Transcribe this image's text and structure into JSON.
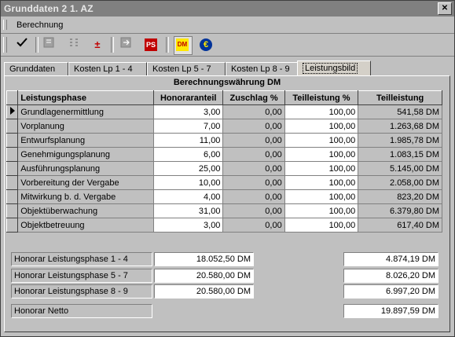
{
  "window": {
    "title": "Grunddaten 2 1. AZ"
  },
  "menu": {
    "items": [
      "Berechnung"
    ]
  },
  "toolbar": {
    "icons": [
      "checkmark-icon",
      "calc-icon",
      "split-icon",
      "plus-minus-icon",
      "export-icon",
      "ps-icon",
      "dm-currency-icon",
      "euro-currency-icon"
    ],
    "ps_label": "PS",
    "dm_label": "DM",
    "euro_label": "€"
  },
  "tabs": [
    {
      "label": "Grunddaten",
      "active": false
    },
    {
      "label": "Kosten Lp 1 - 4",
      "active": false
    },
    {
      "label": "Kosten Lp 5 - 7",
      "active": false
    },
    {
      "label": "Kosten Lp 8 - 9",
      "active": false
    },
    {
      "label": "Leistungsbild",
      "active": true
    }
  ],
  "grid": {
    "caption": "Berechnungswährung DM",
    "headers": [
      "Leistungsphase",
      "Honoraranteil",
      "Zuschlag %",
      "Teilleistung %",
      "Teilleistung"
    ],
    "rows": [
      {
        "phase": "Grundlagenermittlung",
        "honoraranteil": "3,00",
        "zuschlag": "0,00",
        "teilleistung_pct": "100,00",
        "teilleistung": "541,58 DM"
      },
      {
        "phase": "Vorplanung",
        "honoraranteil": "7,00",
        "zuschlag": "0,00",
        "teilleistung_pct": "100,00",
        "teilleistung": "1.263,68 DM"
      },
      {
        "phase": "Entwurfsplanung",
        "honoraranteil": "11,00",
        "zuschlag": "0,00",
        "teilleistung_pct": "100,00",
        "teilleistung": "1.985,78 DM"
      },
      {
        "phase": "Genehmigungsplanung",
        "honoraranteil": "6,00",
        "zuschlag": "0,00",
        "teilleistung_pct": "100,00",
        "teilleistung": "1.083,15 DM"
      },
      {
        "phase": "Ausführungsplanung",
        "honoraranteil": "25,00",
        "zuschlag": "0,00",
        "teilleistung_pct": "100,00",
        "teilleistung": "5.145,00 DM"
      },
      {
        "phase": "Vorbereitung der Vergabe",
        "honoraranteil": "10,00",
        "zuschlag": "0,00",
        "teilleistung_pct": "100,00",
        "teilleistung": "2.058,00 DM"
      },
      {
        "phase": "Mitwirkung b. d. Vergabe",
        "honoraranteil": "4,00",
        "zuschlag": "0,00",
        "teilleistung_pct": "100,00",
        "teilleistung": "823,20 DM"
      },
      {
        "phase": "Objektüberwachung",
        "honoraranteil": "31,00",
        "zuschlag": "0,00",
        "teilleistung_pct": "100,00",
        "teilleistung": "6.379,80 DM"
      },
      {
        "phase": "Objektbetreuung",
        "honoraranteil": "3,00",
        "zuschlag": "0,00",
        "teilleistung_pct": "100,00",
        "teilleistung": "617,40 DM"
      }
    ]
  },
  "summary": {
    "lp14_label": "Honorar Leistungsphase 1 - 4",
    "lp14_honorar": "18.052,50 DM",
    "lp14_teil": "4.874,19 DM",
    "lp57_label": "Honorar Leistungsphase 5 - 7",
    "lp57_honorar": "20.580,00 DM",
    "lp57_teil": "8.026,20 DM",
    "lp89_label": "Honorar Leistungsphase 8 - 9",
    "lp89_honorar": "20.580,00 DM",
    "lp89_teil": "6.997,20 DM",
    "netto_label": "Honorar Netto",
    "netto_value": "19.897,59 DM"
  }
}
